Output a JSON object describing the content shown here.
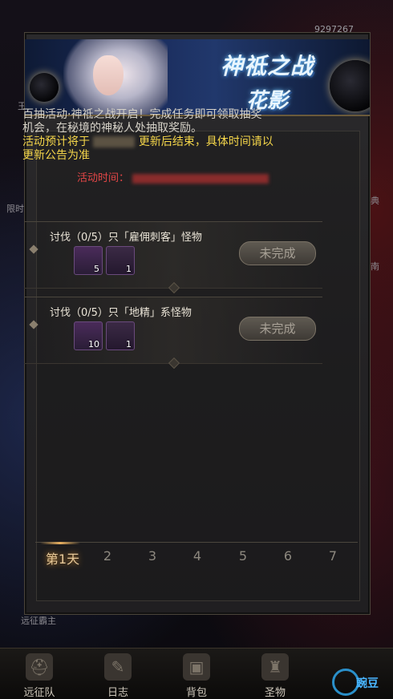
{
  "background": {
    "top_number": "9297267",
    "top_left_label": "王一",
    "side_left": "限时",
    "side_right_1": "典",
    "side_right_2": "南",
    "bottom_left": "远征霸主"
  },
  "banner": {
    "title_line1": "神祗之战",
    "title_line2": "花影"
  },
  "description": {
    "line1": "百抽活动·神祗之战开启！完成任务即可领取抽奖",
    "line2": "机会，在秘境的神秘人处抽取奖励。",
    "notice_prefix": "活动预计将于",
    "notice_suffix": "更新后结束，具体时间请以",
    "notice_line2": "更新公告为准",
    "time_label": "活动时间："
  },
  "tasks": [
    {
      "title": "讨伐（0/5）只「雇佣刺客」怪物",
      "rewards": [
        {
          "icon": "crystal-icon",
          "count": "5"
        },
        {
          "icon": "scroll-icon",
          "count": "1"
        }
      ],
      "status": "未完成"
    },
    {
      "title": "讨伐（0/5）只「地精」系怪物",
      "rewards": [
        {
          "icon": "crystal-icon",
          "count": "10"
        },
        {
          "icon": "scroll-icon",
          "count": "1"
        }
      ],
      "status": "未完成"
    }
  ],
  "days": [
    "第1天",
    "2",
    "3",
    "4",
    "5",
    "6",
    "7"
  ],
  "nav": [
    {
      "label": "远征队",
      "icon": "helmet-icon"
    },
    {
      "label": "日志",
      "icon": "log-icon"
    },
    {
      "label": "背包",
      "icon": "bag-icon"
    },
    {
      "label": "圣物",
      "icon": "relic-icon"
    }
  ],
  "watermark": {
    "text": "豌豆"
  },
  "colors": {
    "accent_gold": "#f5d64a",
    "time_red": "#e24646"
  }
}
